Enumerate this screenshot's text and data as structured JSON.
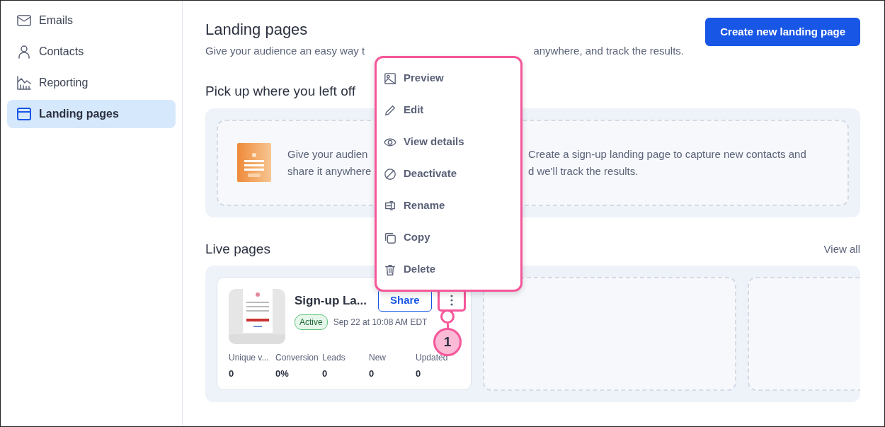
{
  "sidebar": {
    "items": [
      {
        "label": "Emails",
        "selected": false
      },
      {
        "label": "Contacts",
        "selected": false
      },
      {
        "label": "Reporting",
        "selected": false
      },
      {
        "label": "Landing pages",
        "selected": true
      }
    ]
  },
  "header": {
    "title": "Landing pages",
    "subtitle_parts": [
      "Give your audience an easy way t",
      "anywhere, and track the results."
    ],
    "create_button": "Create new landing page"
  },
  "pick_up": {
    "heading": "Pick up where you left off",
    "text_left": [
      "Give your audien",
      "share it anywhere"
    ],
    "text_right": [
      "Create a sign-up landing page to capture new contacts and",
      "d we'll track the results."
    ]
  },
  "live": {
    "heading": "Live pages",
    "view_all": "View all",
    "page": {
      "name": "Sign-up La...",
      "share": "Share",
      "status": "Active",
      "date": "Sep 22 at 10:08 AM EDT",
      "stats": [
        {
          "label": "Unique v...",
          "value": "0"
        },
        {
          "label": "Conversion",
          "value": "0%"
        },
        {
          "label": "Leads",
          "value": "0"
        },
        {
          "label": "New",
          "value": "0"
        },
        {
          "label": "Updated",
          "value": "0"
        }
      ]
    }
  },
  "menu": {
    "items": [
      {
        "label": "Preview"
      },
      {
        "label": "Edit"
      },
      {
        "label": "View details"
      },
      {
        "label": "Deactivate"
      },
      {
        "label": "Rename"
      },
      {
        "label": "Copy"
      },
      {
        "label": "Delete"
      }
    ]
  },
  "callout": {
    "label": "1"
  }
}
